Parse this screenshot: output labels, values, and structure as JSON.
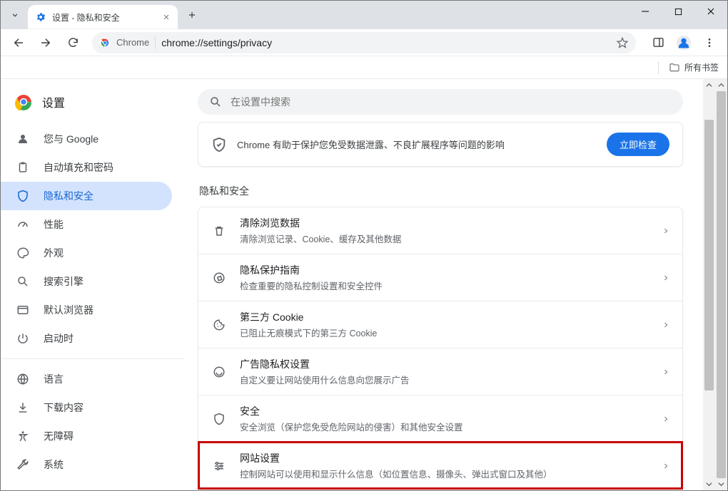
{
  "titlebar": {
    "tab_title": "设置 - 隐私和安全"
  },
  "toolbar": {
    "chip_label": "Chrome",
    "url": "chrome://settings/privacy"
  },
  "bookmarks": {
    "all_bookmarks": "所有书签"
  },
  "brand": {
    "title": "设置"
  },
  "sidebar": {
    "items": [
      {
        "label": "您与 Google"
      },
      {
        "label": "自动填充和密码"
      },
      {
        "label": "隐私和安全"
      },
      {
        "label": "性能"
      },
      {
        "label": "外观"
      },
      {
        "label": "搜索引擎"
      },
      {
        "label": "默认浏览器"
      },
      {
        "label": "启动时"
      }
    ],
    "items2": [
      {
        "label": "语言"
      },
      {
        "label": "下载内容"
      },
      {
        "label": "无障碍"
      },
      {
        "label": "系统"
      }
    ]
  },
  "search": {
    "placeholder": "在设置中搜索"
  },
  "safety": {
    "text": "Chrome 有助于保护您免受数据泄露、不良扩展程序等问题的影响",
    "button": "立即检查"
  },
  "section": {
    "title": "隐私和安全",
    "rows": [
      {
        "title": "清除浏览数据",
        "sub": "清除浏览记录、Cookie、缓存及其他数据"
      },
      {
        "title": "隐私保护指南",
        "sub": "检查重要的隐私控制设置和安全控件"
      },
      {
        "title": "第三方 Cookie",
        "sub": "已阻止无痕模式下的第三方 Cookie"
      },
      {
        "title": "广告隐私权设置",
        "sub": "自定义要让网站使用什么信息向您展示广告"
      },
      {
        "title": "安全",
        "sub": "安全浏览（保护您免受危险网站的侵害）和其他安全设置"
      },
      {
        "title": "网站设置",
        "sub": "控制网站可以使用和显示什么信息（如位置信息、摄像头、弹出式窗口及其他）"
      }
    ]
  }
}
